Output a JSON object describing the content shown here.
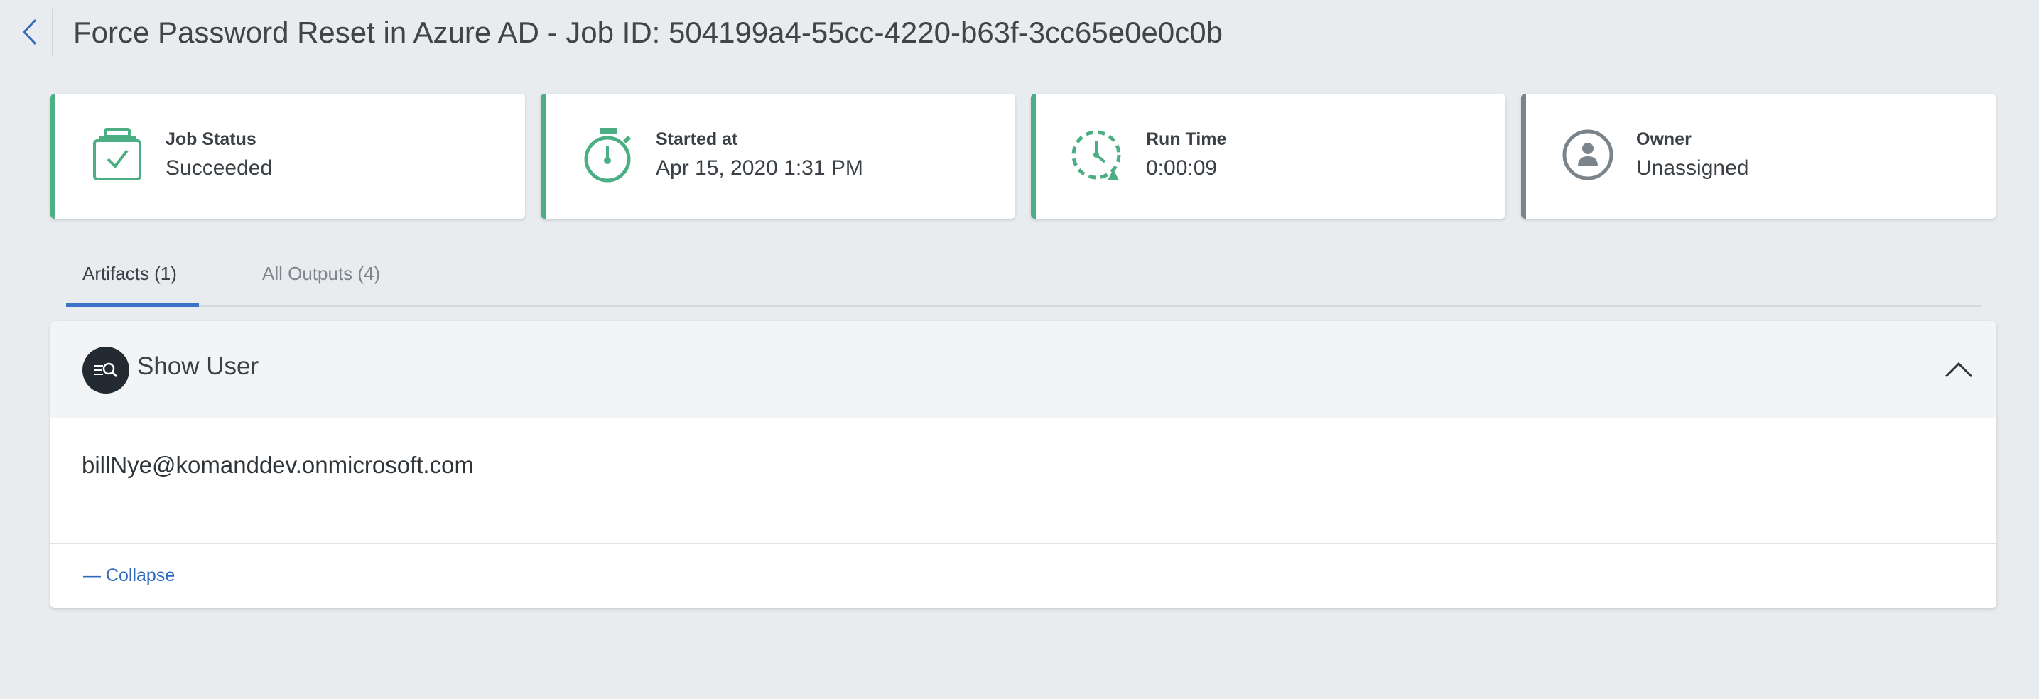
{
  "header": {
    "title": "Force Password Reset in Azure AD - Job ID: 504199a4-55cc-4220-b63f-3cc65e0e0c0b"
  },
  "cards": [
    {
      "label": "Job Status",
      "value": "Succeeded",
      "icon": "clipboard-check-icon",
      "accent": "#4caf84"
    },
    {
      "label": "Started at",
      "value": "Apr 15, 2020 1:31 PM",
      "icon": "stopwatch-icon",
      "accent": "#4caf84"
    },
    {
      "label": "Run Time",
      "value": "0:00:09",
      "icon": "clock-refresh-icon",
      "accent": "#4caf84"
    },
    {
      "label": "Owner",
      "value": "Unassigned",
      "icon": "user-circle-icon",
      "accent": "#7c848b"
    }
  ],
  "tabs": {
    "artifacts": "Artifacts (1)",
    "outputs": "All Outputs (4)",
    "active_color": "#3a73c8"
  },
  "artifact": {
    "title": "Show User",
    "icon": "search-list-icon",
    "value": "billNye@komanddev.onmicrosoft.com",
    "collapse_label": "— Collapse"
  },
  "colors": {
    "background": "#e9ecef",
    "accent_green": "#4caf84",
    "link_blue": "#2f6bbd"
  }
}
